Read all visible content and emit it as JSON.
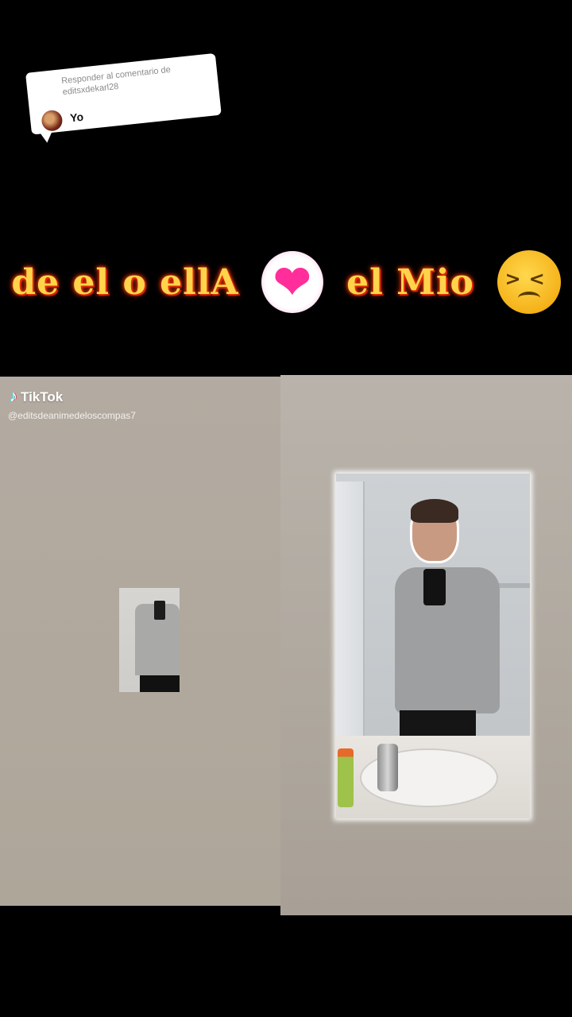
{
  "reply": {
    "header": "Responder al comentario de editsxdekarl28",
    "text": "Yo"
  },
  "caption": {
    "part1": "de el o ellA",
    "part2": "el Mio",
    "heart_emoji": "growing-heart",
    "face_emoji": "persevering-face"
  },
  "watermark": {
    "brand": "TikTok",
    "handle": "@editsdeanimedeloscompas7"
  },
  "colors": {
    "caption_fill": "#ffd44a",
    "caption_glow": "#ff3a0a",
    "background": "#000000",
    "panel": "#b3aba1"
  }
}
